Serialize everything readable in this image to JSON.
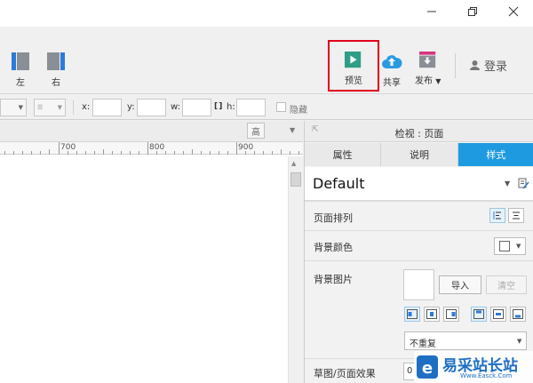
{
  "toolbar": {
    "left_label": "左",
    "right_label": "右",
    "preview_label": "预览",
    "share_label": "共享",
    "publish_label": "发布",
    "login_label": "登录"
  },
  "format_bar": {
    "x_label": "x:",
    "y_label": "y:",
    "w_label": "w:",
    "h_label": "h:",
    "hidden_label": "隐藏"
  },
  "ruler": {
    "ticks": [
      "700",
      "800",
      "900"
    ],
    "high_label": "高"
  },
  "panel": {
    "title": "检视 : 页面",
    "tabs": [
      "属性",
      "说明",
      "样式"
    ],
    "style_name": "Default",
    "page_align_label": "页面排列",
    "bg_color_label": "背景颜色",
    "bg_image_label": "背景图片",
    "import_label": "导入",
    "clear_label": "清空",
    "repeat_value": "不重复",
    "sketch_label": "草图/页面效果",
    "sketch_value": "0"
  },
  "watermark": {
    "text": "易采站长站",
    "sub": "Www.Easck.Com"
  },
  "colors": {
    "accent": "#1e9be0",
    "highlight_box": "#e0001a",
    "preview_green": "#2e9e86",
    "share_blue": "#2a9be3",
    "publish_pink": "#d8337f"
  }
}
